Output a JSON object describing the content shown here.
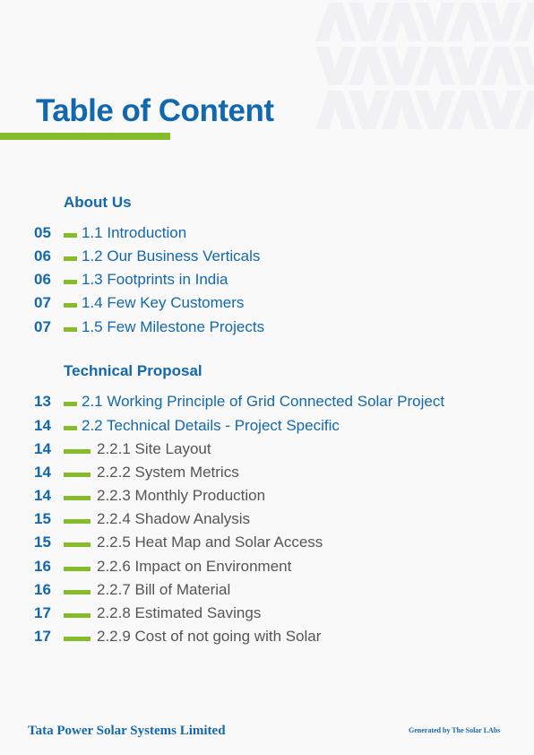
{
  "title": "Table of Content",
  "colors": {
    "accent": "#1268ae",
    "green": "#86bc2b",
    "text": "#555555"
  },
  "sections": [
    {
      "heading": "About Us",
      "items": [
        {
          "page": "05",
          "label": "1.1 Introduction",
          "level": 1
        },
        {
          "page": "06",
          "label": "1.2 Our Business Verticals",
          "level": 1
        },
        {
          "page": "06",
          "label": "1.3 Footprints in India",
          "level": 1
        },
        {
          "page": "07",
          "label": "1.4 Few Key Customers",
          "level": 1
        },
        {
          "page": "07",
          "label": "1.5 Few Milestone Projects",
          "level": 1
        }
      ]
    },
    {
      "heading": "Technical Proposal",
      "items": [
        {
          "page": "13",
          "label": "2.1 Working Principle of Grid Connected Solar Project",
          "level": 1
        },
        {
          "page": "14",
          "label": "2.2 Technical Details - Project Specific",
          "level": 1
        },
        {
          "page": "14",
          "label": "2.2.1 Site Layout",
          "level": 2
        },
        {
          "page": "14",
          "label": "2.2.2 System Metrics",
          "level": 2
        },
        {
          "page": "14",
          "label": "2.2.3 Monthly Production",
          "level": 2
        },
        {
          "page": "15",
          "label": "2.2.4 Shadow Analysis",
          "level": 2
        },
        {
          "page": "15",
          "label": "2.2.5 Heat Map and Solar Access",
          "level": 2
        },
        {
          "page": "16",
          "label": "2.2.6 Impact on Environment",
          "level": 2
        },
        {
          "page": "16",
          "label": "2.2.7 Bill of Material",
          "level": 2
        },
        {
          "page": "17",
          "label": "2.2.8 Estimated Savings",
          "level": 2
        },
        {
          "page": "17",
          "label": "2.2.9 Cost of not going with Solar",
          "level": 2
        }
      ]
    }
  ],
  "footer": {
    "company": "Tata Power Solar Systems Limited",
    "generated": "Generated by  The Solar LAbs"
  }
}
